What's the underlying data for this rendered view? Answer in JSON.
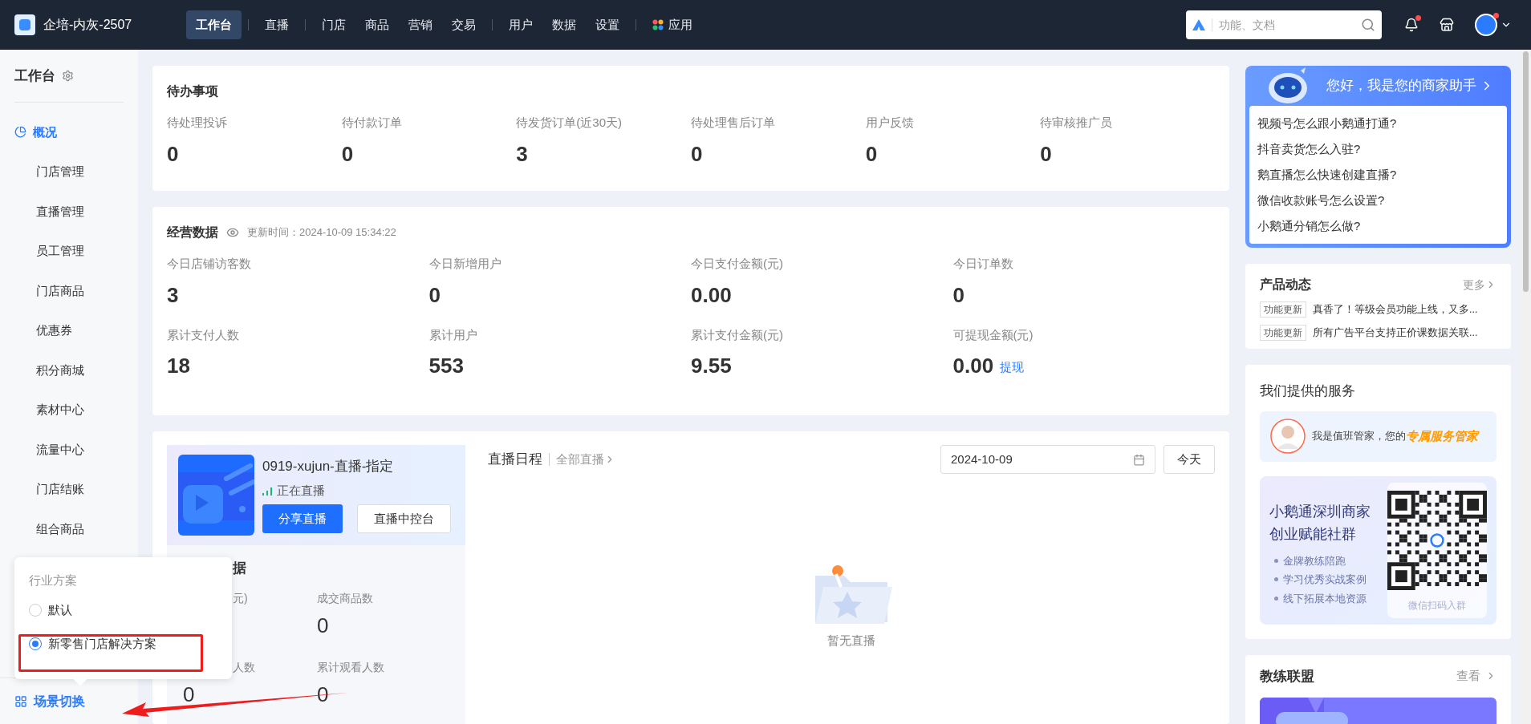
{
  "topbar": {
    "shop_name": "企培-内灰-2507",
    "nav_groups": [
      [
        {
          "label": "工作台",
          "selected": true
        }
      ],
      [
        {
          "label": "直播",
          "selected": false
        }
      ],
      [
        {
          "label": "门店",
          "selected": false
        },
        {
          "label": "商品",
          "selected": false
        },
        {
          "label": "营销",
          "selected": false
        },
        {
          "label": "交易",
          "selected": false
        }
      ],
      [
        {
          "label": "用户",
          "selected": false
        },
        {
          "label": "数据",
          "selected": false
        },
        {
          "label": "设置",
          "selected": false
        }
      ],
      [
        {
          "label": "应用",
          "selected": false,
          "kind": "apps"
        }
      ]
    ],
    "search": {
      "placeholder": "功能、文档"
    },
    "notification_dot": true,
    "avatar_dot": true
  },
  "sidebar": {
    "title": "工作台",
    "items": [
      {
        "label": "概况",
        "selected": true,
        "kind": "with-icon"
      },
      {
        "label": "门店管理",
        "selected": false,
        "kind": "plain"
      },
      {
        "label": "直播管理",
        "selected": false,
        "kind": "plain"
      },
      {
        "label": "员工管理",
        "selected": false,
        "kind": "plain"
      },
      {
        "label": "门店商品",
        "selected": false,
        "kind": "plain"
      },
      {
        "label": "优惠券",
        "selected": false,
        "kind": "plain"
      },
      {
        "label": "积分商城",
        "selected": false,
        "kind": "plain"
      },
      {
        "label": "素材中心",
        "selected": false,
        "kind": "plain"
      },
      {
        "label": "流量中心",
        "selected": false,
        "kind": "plain"
      },
      {
        "label": "门店结账",
        "selected": false,
        "kind": "plain"
      },
      {
        "label": "组合商品",
        "selected": false,
        "kind": "plain"
      }
    ],
    "footer": "场景切换"
  },
  "scene_popup": {
    "title": "行业方案",
    "options": [
      {
        "label": "默认",
        "selected": false
      },
      {
        "label": "新零售门店解决方案",
        "selected": true
      }
    ]
  },
  "todo": {
    "title": "待办事项",
    "items": [
      {
        "label": "待处理投诉",
        "value": "0"
      },
      {
        "label": "待付款订单",
        "value": "0"
      },
      {
        "label": "待发货订单(近30天)",
        "value": "3"
      },
      {
        "label": "待处理售后订单",
        "value": "0"
      },
      {
        "label": "用户反馈",
        "value": "0"
      },
      {
        "label": "待审核推广员",
        "value": "0"
      }
    ]
  },
  "business": {
    "title": "经营数据",
    "update_time": "更新时间：2024-10-09 15:34:22",
    "items": [
      {
        "label": "今日店铺访客数",
        "value": "3"
      },
      {
        "label": "今日新增用户",
        "value": "0"
      },
      {
        "label": "今日支付金额(元)",
        "value": "0.00"
      },
      {
        "label": "今日订单数",
        "value": "0"
      },
      {
        "label": "累计支付人数",
        "value": "18"
      },
      {
        "label": "累计用户",
        "value": "553"
      },
      {
        "label": "累计支付金额(元)",
        "value": "9.55"
      },
      {
        "label": "可提现金额(元)",
        "value": "0.00",
        "link": "提现"
      }
    ]
  },
  "live": {
    "name": "0919-xujun-直播-指定",
    "status": "正在直播",
    "buttons": [
      {
        "label": "分享直播",
        "kind": "primary"
      },
      {
        "label": "直播中控台",
        "kind": "secondary"
      }
    ],
    "stats_title": "据",
    "stats": [
      {
        "label": "元)"
      },
      {
        "label": "成交商品数",
        "value": "0"
      },
      {
        "label": "人数",
        "value": "0"
      },
      {
        "label": "累计观看人数",
        "value": "0"
      }
    ]
  },
  "schedule": {
    "title": "直播日程",
    "link": "全部直播",
    "date": "2024-10-09",
    "today_button": "今天",
    "empty": "暂无直播"
  },
  "assistant": {
    "title": "您好，我是您的商家助手",
    "questions": [
      "视频号怎么跟小鹅通打通?",
      "抖音卖货怎么入驻?",
      "鹅直播怎么快速创建直播?",
      "微信收款账号怎么设置?",
      "小鹅通分销怎么做?"
    ]
  },
  "news": {
    "title": "产品动态",
    "more": "更多",
    "items": [
      {
        "tag": "功能更新",
        "text": "真香了！等级会员功能上线，又多..."
      },
      {
        "tag": "功能更新",
        "text": "所有广告平台支持正价课数据关联..."
      }
    ]
  },
  "services": {
    "title": "我们提供的服务",
    "butler_intro": "我是值班管家，您的",
    "butler_highlight": "专属服务管家",
    "community_title": [
      "小鹅通深圳商家",
      "创业赋能社群"
    ],
    "community_points": [
      "金牌教练陪跑",
      "学习优秀实战案例",
      "线下拓展本地资源"
    ],
    "qr_caption": "微信扫码入群"
  },
  "coach": {
    "title": "教练联盟",
    "more": "查看"
  }
}
